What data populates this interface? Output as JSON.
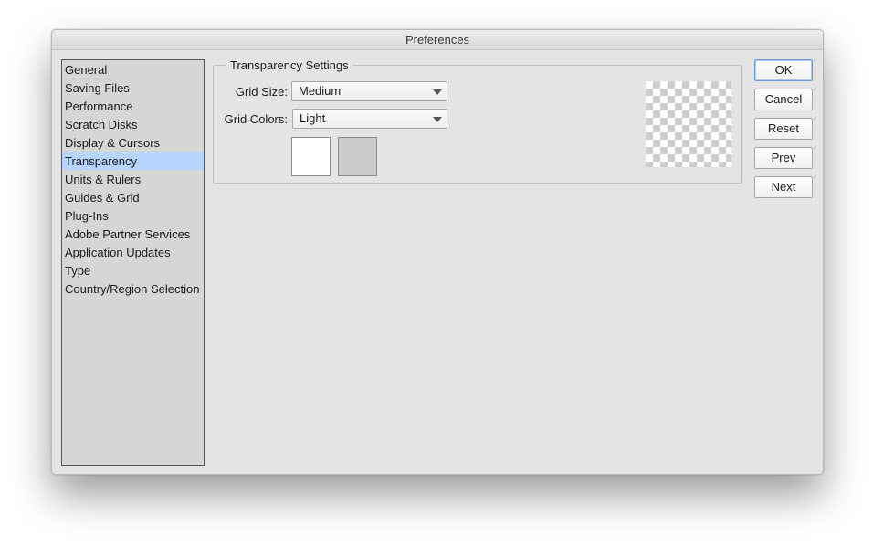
{
  "window": {
    "title": "Preferences"
  },
  "sidebar": {
    "selected_index": 5,
    "items": [
      {
        "label": "General"
      },
      {
        "label": "Saving Files"
      },
      {
        "label": "Performance"
      },
      {
        "label": "Scratch Disks"
      },
      {
        "label": "Display & Cursors"
      },
      {
        "label": "Transparency"
      },
      {
        "label": "Units & Rulers"
      },
      {
        "label": "Guides & Grid"
      },
      {
        "label": "Plug-Ins"
      },
      {
        "label": "Adobe Partner Services"
      },
      {
        "label": "Application Updates"
      },
      {
        "label": "Type"
      },
      {
        "label": "Country/Region Selection"
      }
    ]
  },
  "transparency_settings": {
    "group_title": "Transparency Settings",
    "grid_size": {
      "label": "Grid Size:",
      "value": "Medium"
    },
    "grid_colors": {
      "label": "Grid Colors:",
      "value": "Light",
      "swatch_1_color": "#ffffff",
      "swatch_2_color": "#cccccc"
    },
    "preview": {
      "color_light": "#ffffff",
      "color_dark": "#cccccc"
    }
  },
  "buttons": {
    "ok": "OK",
    "cancel": "Cancel",
    "reset": "Reset",
    "prev": "Prev",
    "next": "Next"
  },
  "colors": {
    "selection_highlight": "#b5d5fc",
    "default_button_border": "#6a9fd8"
  }
}
